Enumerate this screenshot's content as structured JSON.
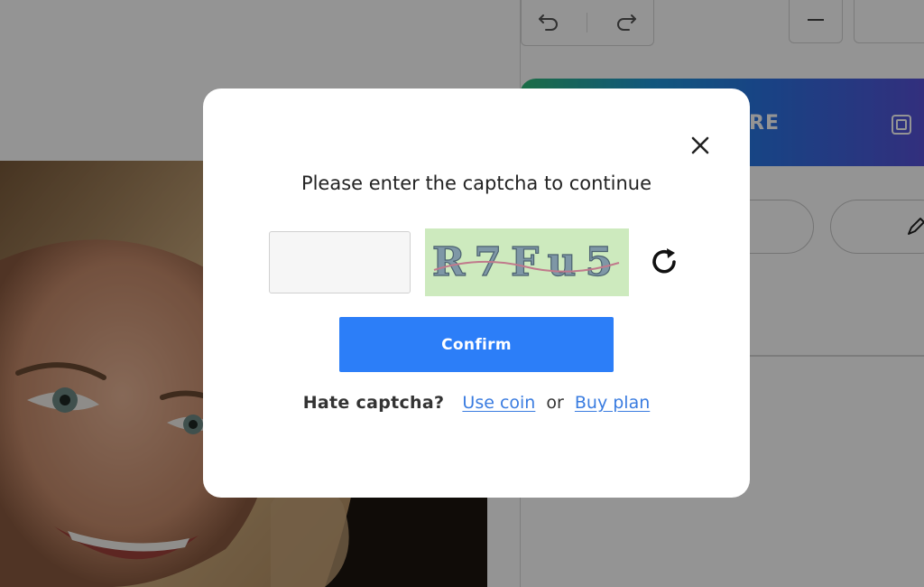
{
  "background": {
    "banner": {
      "label": "RE",
      "icon": "copy-icon"
    },
    "toolbar": {
      "undo_icon": "undo-icon",
      "redo_icon": "redo-icon",
      "zoom_out_icon": "minus-icon"
    },
    "pen_icon": "pen-icon"
  },
  "modal": {
    "title": "Please enter the captcha to continue",
    "input": {
      "value": "",
      "placeholder": ""
    },
    "captcha_text": "R7Fu5",
    "refresh_icon": "refresh-icon",
    "close_icon": "close-icon",
    "confirm_label": "Confirm",
    "footer": {
      "prompt": "Hate captcha?",
      "use_coin_label": "Use coin",
      "or_label": "or",
      "buy_plan_label": "Buy plan"
    }
  },
  "colors": {
    "primary": "#2c7ef8",
    "link": "#3a7ce0",
    "captcha_bg": "#cdeabe",
    "overlay": "rgba(0,0,0,0.42)"
  }
}
